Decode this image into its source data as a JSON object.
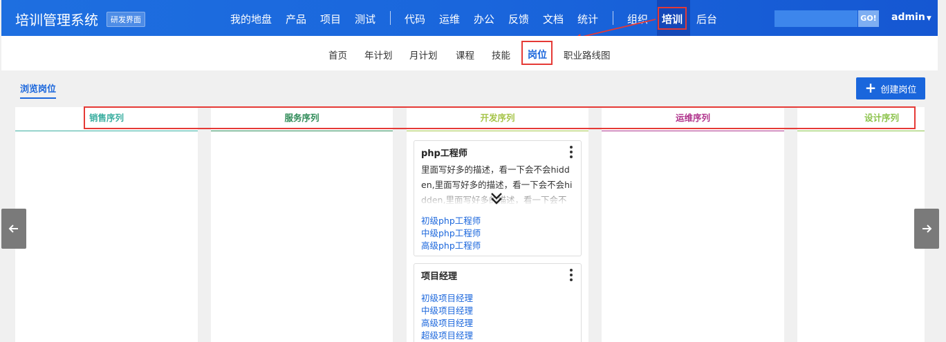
{
  "header": {
    "brand": "培训管理系统",
    "env_badge": "研发界面",
    "nav": [
      "我的地盘",
      "产品",
      "项目",
      "测试",
      "代码",
      "运维",
      "办公",
      "反馈",
      "文档",
      "统计",
      "组织",
      "培训",
      "后台"
    ],
    "active_nav": "培训",
    "search_value": "",
    "go_label": "GO!",
    "user": "admin"
  },
  "subnav": {
    "items": [
      "首页",
      "年计划",
      "月计划",
      "课程",
      "技能",
      "岗位",
      "职业路线图"
    ],
    "active": "岗位"
  },
  "page": {
    "tab_label": "浏览岗位",
    "create_button": "创建岗位"
  },
  "columns": [
    {
      "name": "销售序列",
      "color": "#3aaea0"
    },
    {
      "name": "服务序列",
      "color": "#2e8b57"
    },
    {
      "name": "开发序列",
      "color": "#a6c44a"
    },
    {
      "name": "运维序列",
      "color": "#b0338c"
    },
    {
      "name": "设计序列",
      "color": "#8bc34a"
    }
  ],
  "cards": [
    {
      "title": "php工程师",
      "description": "里面写好多的描述，看一下会不会hidden,里面写好多的描述，看一下会不会hidden,里面写好多的描述，看一下会不会hidden",
      "links": [
        "初级php工程师",
        "中级php工程师",
        "高级php工程师"
      ]
    },
    {
      "title": "项目经理",
      "description": "",
      "links": [
        "初级项目经理",
        "中级项目经理",
        "高级项目经理",
        "超级项目经理"
      ]
    }
  ]
}
